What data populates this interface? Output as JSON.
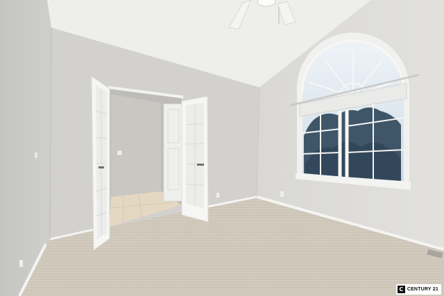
{
  "photo": {
    "watermark": {
      "brand": "CENTURY 21",
      "logo_letter": "C",
      "icon": "century21-logo-icon"
    },
    "colors": {
      "wall_left": "#c9c9c7",
      "wall_back": "#d4d3d0",
      "wall_right": "#dddcd9",
      "ceiling": "#ececeb",
      "carpet": "#cfc7b9",
      "trim": "#f4f4f2",
      "sky": "#dbe6f0",
      "trees": "#3f5568"
    }
  }
}
